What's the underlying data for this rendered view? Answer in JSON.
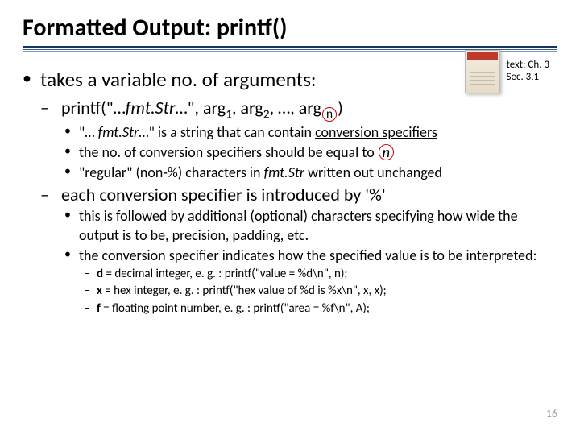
{
  "title": "Formatted Output: printf()",
  "textref_line1": "text: Ch. 3",
  "textref_line2": "Sec. 3.1",
  "b1": "takes a variable no. of arguments:",
  "b2_pre": "printf(\"…",
  "b2_fmt": "fmt.Str",
  "b2_mid": "…\", arg",
  "b2_s1": "1",
  "b2_c": ", arg",
  "b2_s2": "2",
  "b2_e": ", …, arg",
  "b2_n": "n",
  "b2_end": ")",
  "b3a_pre": "\"… ",
  "b3a_mid": "…\" is a string that can contain ",
  "b3a_cs": "conversion specifiers",
  "b3b_pre": "the no. of conversion specifiers should be equal to ",
  "b3b_n": "n",
  "b3c_pre": "\"regular\" (non-%) characters in ",
  "b3c_post": " written out unchanged",
  "b4": "each conversion specifier is introduced by '%'",
  "b5a": "this is followed by additional (optional) characters specifying how wide the output is to be, precision, padding, etc.",
  "b5b": "the conversion specifier indicates how the specified value is to be interpreted:",
  "b6a_l": "d",
  "b6a_r": " = decimal integer, e. g. : printf(\"value = %d\\n\", n);",
  "b6b_l": "x",
  "b6b_r": " = hex integer, e. g. : printf(\"hex value of %d is %x\\n\", x, x);",
  "b6c_l": "f",
  "b6c_r": " = floating point number, e. g. : printf(\"area = %f\\n\", A);",
  "pagenum": "16"
}
